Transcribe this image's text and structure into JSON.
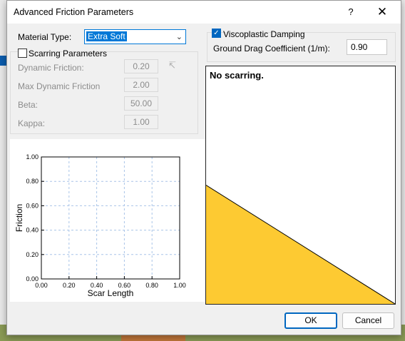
{
  "dialog": {
    "title": "Advanced Friction Parameters",
    "help_label": "?",
    "close_label": "✕"
  },
  "material": {
    "label": "Material Type:",
    "selected": "Extra Soft"
  },
  "scarring": {
    "checkbox_label": "Scarring Parameters",
    "checked": false,
    "fields": [
      {
        "label": "Dynamic Friction:",
        "value": "0.20"
      },
      {
        "label": "Max Dynamic Friction",
        "value": "2.00"
      },
      {
        "label": "Beta:",
        "value": "50.00"
      },
      {
        "label": "Kappa:",
        "value": "1.00"
      }
    ]
  },
  "viscoplastic": {
    "checkbox_label": "Viscoplastic Damping",
    "checked": true,
    "drag_label": "Ground Drag Coefficient (1/m):",
    "drag_value": "0.90"
  },
  "preview": {
    "message": "No scarring.",
    "fill_color": "#fdca32",
    "line_start_y_fraction": 0.5,
    "line_end_y_fraction": 1.0
  },
  "chart_data": {
    "type": "line",
    "title": "",
    "xlabel": "Scar Length",
    "ylabel": "Friction",
    "xlim": [
      0,
      1
    ],
    "ylim": [
      0,
      1
    ],
    "xticks": [
      "0.00",
      "0.20",
      "0.40",
      "0.60",
      "0.80",
      "1.00"
    ],
    "yticks": [
      "0.00",
      "0.20",
      "0.40",
      "0.60",
      "0.80",
      "1.00"
    ],
    "grid": true,
    "series": []
  },
  "buttons": {
    "ok": "OK",
    "cancel": "Cancel"
  }
}
